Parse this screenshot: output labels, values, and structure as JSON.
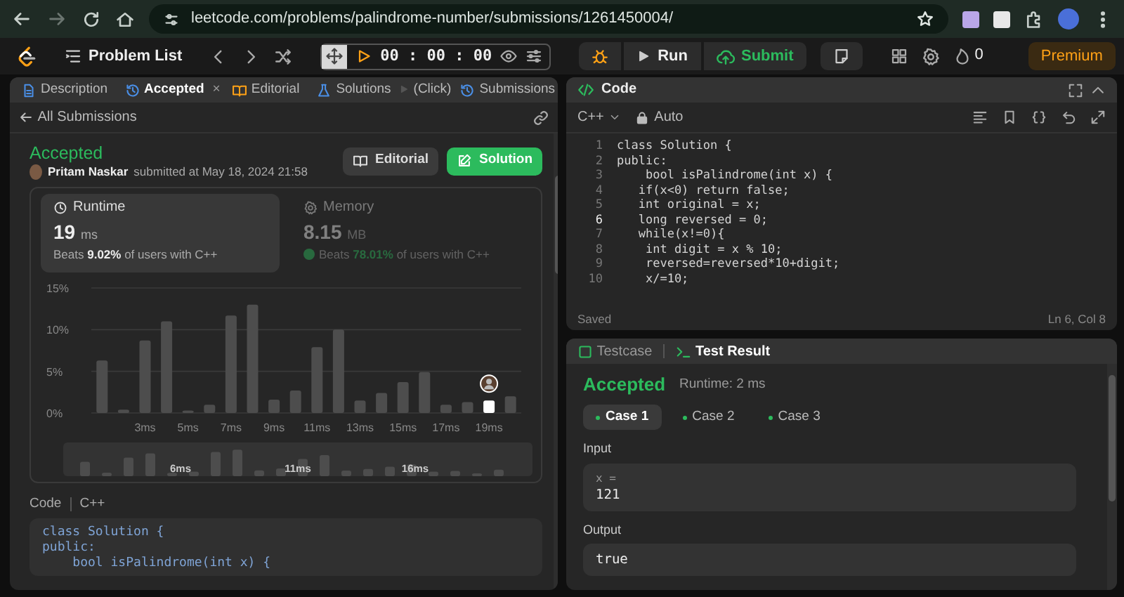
{
  "browser": {
    "url": "leetcode.com/problems/palindrome-number/submissions/1261450004/"
  },
  "nav": {
    "problem_list": "Problem List",
    "timer": "00 : 00 : 00",
    "run": "Run",
    "submit": "Submit",
    "streak": "0",
    "premium": "Premium"
  },
  "left_panel": {
    "tabs": [
      {
        "kind": "tab",
        "label": "Description",
        "selected": false
      },
      {
        "kind": "tab",
        "label": "Accepted",
        "selected": true,
        "close": "×"
      },
      {
        "kind": "tab",
        "label": "Editorial",
        "selected": false
      },
      {
        "kind": "tab",
        "label": "Solutions",
        "selected": false
      },
      {
        "kind": "note",
        "label": "(Click)"
      },
      {
        "kind": "tab",
        "label": "Submissions",
        "selected": false
      }
    ],
    "back_link": "All Submissions",
    "status": "Accepted",
    "author": "Pritam Naskar",
    "submitted": "submitted at May 18, 2024 21:58",
    "buttons": [
      {
        "kind": "secondary",
        "label": "Editorial"
      },
      {
        "kind": "primary",
        "label": "Solution"
      }
    ],
    "stats": [
      {
        "kind": "runtime",
        "label": "Runtime",
        "value": "19",
        "unit": "ms",
        "beats": "Beats",
        "percent": "9.02%",
        "suffix": "of users with C++",
        "selected": true
      },
      {
        "kind": "memory",
        "label": "Memory",
        "value": "8.15",
        "unit": "MB",
        "beats": "Beats",
        "percent": "78.01%",
        "suffix": "of users with C++",
        "selected": false
      }
    ],
    "chart_data": {
      "type": "bar",
      "x": [
        1,
        2,
        3,
        4,
        5,
        6,
        7,
        8,
        9,
        10,
        11,
        12,
        13,
        14,
        15,
        16,
        17,
        18,
        19,
        20
      ],
      "series": [
        {
          "color": "#4d4d4d",
          "values": [
            6.3,
            0.4,
            8.7,
            11.0,
            0.3,
            1.0,
            11.7,
            13.0,
            1.6,
            2.7,
            7.9,
            10.0,
            1.5,
            2.4,
            3.7,
            4.9,
            1.0,
            1.3,
            null,
            2.0
          ]
        },
        {
          "color": "#ffffff",
          "values": [
            null,
            null,
            null,
            null,
            null,
            null,
            null,
            null,
            null,
            null,
            null,
            null,
            null,
            null,
            null,
            null,
            null,
            null,
            1.5,
            null
          ]
        }
      ],
      "xlim": [
        0.5,
        20.5
      ],
      "ylim": [
        0,
        15
      ],
      "xticks": [
        {
          "value": 3,
          "label": "3ms"
        },
        {
          "value": 5,
          "label": "5ms"
        },
        {
          "value": 7,
          "label": "7ms"
        },
        {
          "value": 9,
          "label": "9ms"
        },
        {
          "value": 11,
          "label": "11ms"
        },
        {
          "value": 13,
          "label": "13ms"
        },
        {
          "value": 15,
          "label": "15ms"
        },
        {
          "value": 17,
          "label": "17ms"
        },
        {
          "value": 19,
          "label": "19ms"
        }
      ],
      "yticks": [
        {
          "value": 0,
          "label": "0%"
        },
        {
          "value": 5,
          "label": "5%"
        },
        {
          "value": 10,
          "label": "10%"
        },
        {
          "value": 15,
          "label": "15%"
        }
      ]
    },
    "overview": {
      "labels": [
        "6ms",
        "11ms",
        "16ms"
      ]
    },
    "code": {
      "label": "Code",
      "language": "C++",
      "lines": [
        "class Solution {",
        "public:",
        "    bool isPalindrome(int x) {"
      ]
    }
  },
  "code_panel": {
    "title": "Code",
    "language": "C++",
    "mode": "Auto",
    "lines": [
      {
        "number": "1",
        "text": "class Solution {",
        "selected": false
      },
      {
        "number": "2",
        "text": "public:",
        "selected": false
      },
      {
        "number": "3",
        "text": "    bool isPalindrome(int x) {",
        "selected": false
      },
      {
        "number": "4",
        "text": "   if(x<0) return false;",
        "selected": false
      },
      {
        "number": "5",
        "text": "   int original = x;",
        "selected": false
      },
      {
        "number": "6",
        "text": "   long reversed = 0;",
        "selected": true
      },
      {
        "number": "7",
        "text": "   while(x!=0){",
        "selected": false
      },
      {
        "number": "8",
        "text": "    int digit = x % 10;",
        "selected": false
      },
      {
        "number": "9",
        "text": "    reversed=reversed*10+digit;",
        "selected": false
      },
      {
        "number": "10",
        "text": "    x/=10;",
        "selected": false
      }
    ],
    "status": "Saved",
    "cursor": "Ln 6, Col 8"
  },
  "result_panel": {
    "tabs": [
      {
        "label": "Testcase",
        "selected": false
      },
      {
        "label": "Test Result",
        "selected": true
      }
    ],
    "status": "Accepted",
    "runtime": "Runtime: 2 ms",
    "cases": [
      {
        "label": "Case 1",
        "selected": true
      },
      {
        "label": "Case 2",
        "selected": false
      },
      {
        "label": "Case 3",
        "selected": false
      }
    ],
    "input_label": "Input",
    "input_var": "x =",
    "input_value": "121",
    "output_label": "Output",
    "output_value": "true"
  }
}
